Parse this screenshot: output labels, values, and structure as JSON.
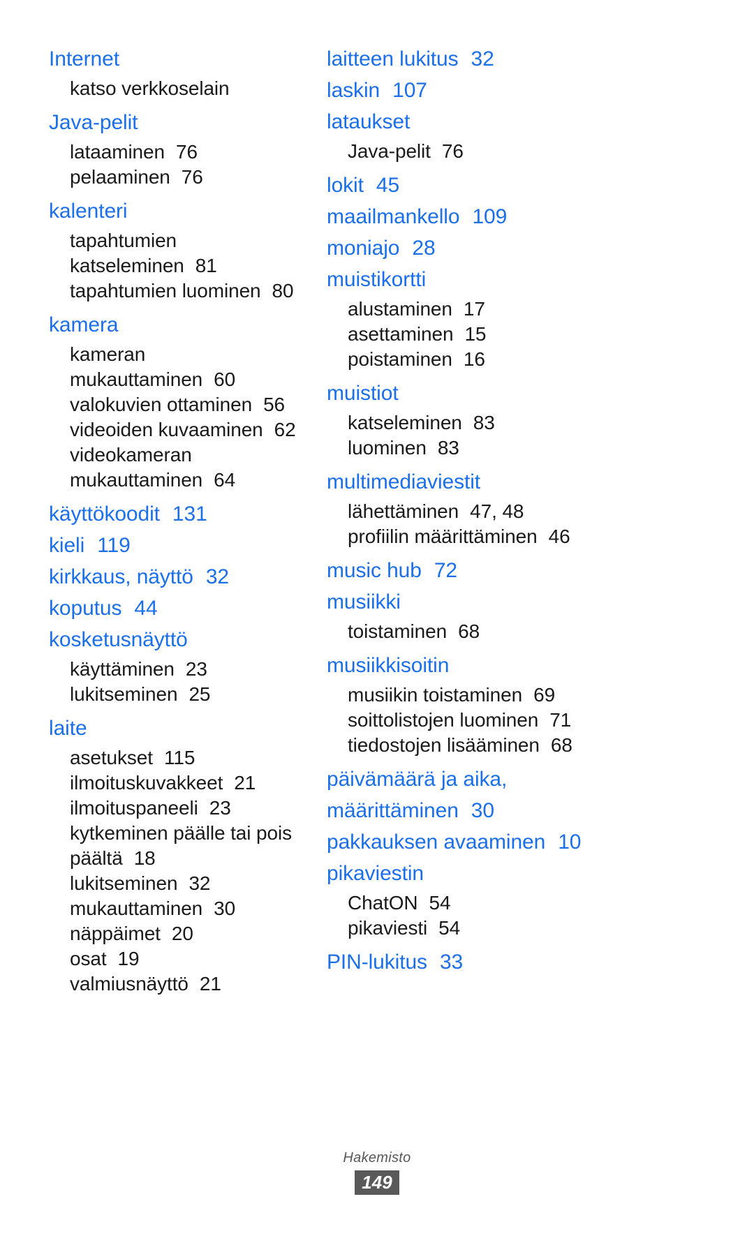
{
  "document": {
    "footer_label": "Hakemisto",
    "page_number": "149",
    "accent_color": "#1b6fe8",
    "text_color": "#1a1a1a",
    "footer_badge_color": "#595959"
  },
  "left_column": [
    {
      "type": "entry",
      "label": "Internet",
      "page": ""
    },
    {
      "type": "sub",
      "label": "katso verkkoselain",
      "page": ""
    },
    {
      "type": "entry",
      "label": "Java-pelit",
      "page": ""
    },
    {
      "type": "sub",
      "label": "lataaminen",
      "page": "76"
    },
    {
      "type": "sub",
      "label": "pelaaminen",
      "page": "76"
    },
    {
      "type": "entry",
      "label": "kalenteri",
      "page": ""
    },
    {
      "type": "sub",
      "label": "tapahtumien",
      "page": ""
    },
    {
      "type": "sub",
      "label": "katseleminen",
      "page": "81"
    },
    {
      "type": "sub",
      "label": "tapahtumien luominen",
      "page": "80"
    },
    {
      "type": "entry",
      "label": "kamera",
      "page": ""
    },
    {
      "type": "sub",
      "label": "kameran",
      "page": ""
    },
    {
      "type": "sub",
      "label": "mukauttaminen",
      "page": "60"
    },
    {
      "type": "sub",
      "label": "valokuvien ottaminen",
      "page": "56"
    },
    {
      "type": "sub",
      "label": "videoiden kuvaaminen",
      "page": "62"
    },
    {
      "type": "sub",
      "label": "videokameran",
      "page": ""
    },
    {
      "type": "sub",
      "label": "mukauttaminen",
      "page": "64"
    },
    {
      "type": "entry",
      "label": "käyttökoodit",
      "page": "131"
    },
    {
      "type": "entry",
      "label": "kieli",
      "page": "119"
    },
    {
      "type": "entry",
      "label": "kirkkaus, näyttö",
      "page": "32"
    },
    {
      "type": "entry",
      "label": "koputus",
      "page": "44"
    },
    {
      "type": "entry",
      "label": "kosketusnäyttö",
      "page": ""
    },
    {
      "type": "sub",
      "label": "käyttäminen",
      "page": "23"
    },
    {
      "type": "sub",
      "label": "lukitseminen",
      "page": "25"
    },
    {
      "type": "entry",
      "label": "laite",
      "page": ""
    },
    {
      "type": "sub",
      "label": "asetukset",
      "page": "115"
    },
    {
      "type": "sub",
      "label": "ilmoituskuvakkeet",
      "page": "21"
    },
    {
      "type": "sub",
      "label": "ilmoituspaneeli",
      "page": "23"
    },
    {
      "type": "sub",
      "label": "kytkeminen päälle tai pois",
      "page": ""
    },
    {
      "type": "sub",
      "label": "päältä",
      "page": "18"
    },
    {
      "type": "sub",
      "label": "lukitseminen",
      "page": "32"
    },
    {
      "type": "sub",
      "label": "mukauttaminen",
      "page": "30"
    },
    {
      "type": "sub",
      "label": "näppäimet",
      "page": "20"
    },
    {
      "type": "sub",
      "label": "osat",
      "page": "19"
    },
    {
      "type": "sub",
      "label": "valmiusnäyttö",
      "page": "21"
    }
  ],
  "right_column": [
    {
      "type": "entry",
      "label": "laitteen lukitus",
      "page": "32"
    },
    {
      "type": "entry",
      "label": "laskin",
      "page": "107"
    },
    {
      "type": "entry",
      "label": "lataukset",
      "page": ""
    },
    {
      "type": "sub",
      "label": "Java-pelit",
      "page": "76"
    },
    {
      "type": "entry",
      "label": "lokit",
      "page": "45"
    },
    {
      "type": "entry",
      "label": "maailmankello",
      "page": "109"
    },
    {
      "type": "entry",
      "label": "moniajo",
      "page": "28"
    },
    {
      "type": "entry",
      "label": "muistikortti",
      "page": ""
    },
    {
      "type": "sub",
      "label": "alustaminen",
      "page": "17"
    },
    {
      "type": "sub",
      "label": "asettaminen",
      "page": "15"
    },
    {
      "type": "sub",
      "label": "poistaminen",
      "page": "16"
    },
    {
      "type": "entry",
      "label": "muistiot",
      "page": ""
    },
    {
      "type": "sub",
      "label": "katseleminen",
      "page": "83"
    },
    {
      "type": "sub",
      "label": "luominen",
      "page": "83"
    },
    {
      "type": "entry",
      "label": "multimediaviestit",
      "page": ""
    },
    {
      "type": "sub",
      "label": "lähettäminen",
      "page": "47, 48"
    },
    {
      "type": "sub",
      "label": "profiilin määrittäminen",
      "page": "46"
    },
    {
      "type": "entry",
      "label": "music hub",
      "page": "72"
    },
    {
      "type": "entry",
      "label": "musiikki",
      "page": ""
    },
    {
      "type": "sub",
      "label": "toistaminen",
      "page": "68"
    },
    {
      "type": "entry",
      "label": "musiikkisoitin",
      "page": ""
    },
    {
      "type": "sub",
      "label": "musiikin toistaminen",
      "page": "69"
    },
    {
      "type": "sub",
      "label": "soittolistojen luominen",
      "page": "71"
    },
    {
      "type": "sub",
      "label": "tiedostojen lisääminen",
      "page": "68"
    },
    {
      "type": "entry",
      "label": "päivämäärä ja aika,",
      "page": ""
    },
    {
      "type": "entry",
      "label": "määrittäminen",
      "page": "30"
    },
    {
      "type": "entry",
      "label": "pakkauksen avaaminen",
      "page": "10"
    },
    {
      "type": "entry",
      "label": "pikaviestin",
      "page": ""
    },
    {
      "type": "sub",
      "label": "ChatON",
      "page": "54"
    },
    {
      "type": "sub",
      "label": "pikaviesti",
      "page": "54"
    },
    {
      "type": "entry",
      "label": "PIN-lukitus",
      "page": "33"
    }
  ]
}
